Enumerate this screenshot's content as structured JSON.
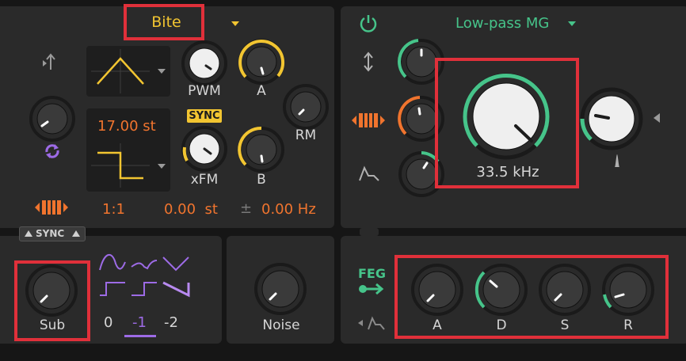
{
  "osc": {
    "preset_name": "Bite",
    "labels": {
      "pwm": "PWM",
      "a": "A",
      "rm": "RM",
      "xfm": "xFM",
      "b": "B"
    },
    "sync_badge": "SYNC",
    "pitch_value": "17.00 st",
    "ratio": "1:1",
    "semitone_offset": "0.00  st",
    "plus_minus": "±",
    "hz_offset": "0.00 Hz",
    "sync_button": "SYNC"
  },
  "filter": {
    "type": "Low-pass MG",
    "cutoff_value": "33.5 kHz"
  },
  "sub": {
    "label": "Sub",
    "octaves": [
      "0",
      "-1",
      "-2"
    ],
    "selected_octave": "-1"
  },
  "noise": {
    "label": "Noise"
  },
  "feg": {
    "label": "FEG",
    "knobs": [
      "A",
      "D",
      "S",
      "R"
    ]
  },
  "colors": {
    "accent_orange": "#f0742e",
    "accent_green": "#46c48a",
    "accent_yellow": "#f2c531",
    "accent_purple": "#9d6be6",
    "highlight_red": "#e0303a"
  }
}
